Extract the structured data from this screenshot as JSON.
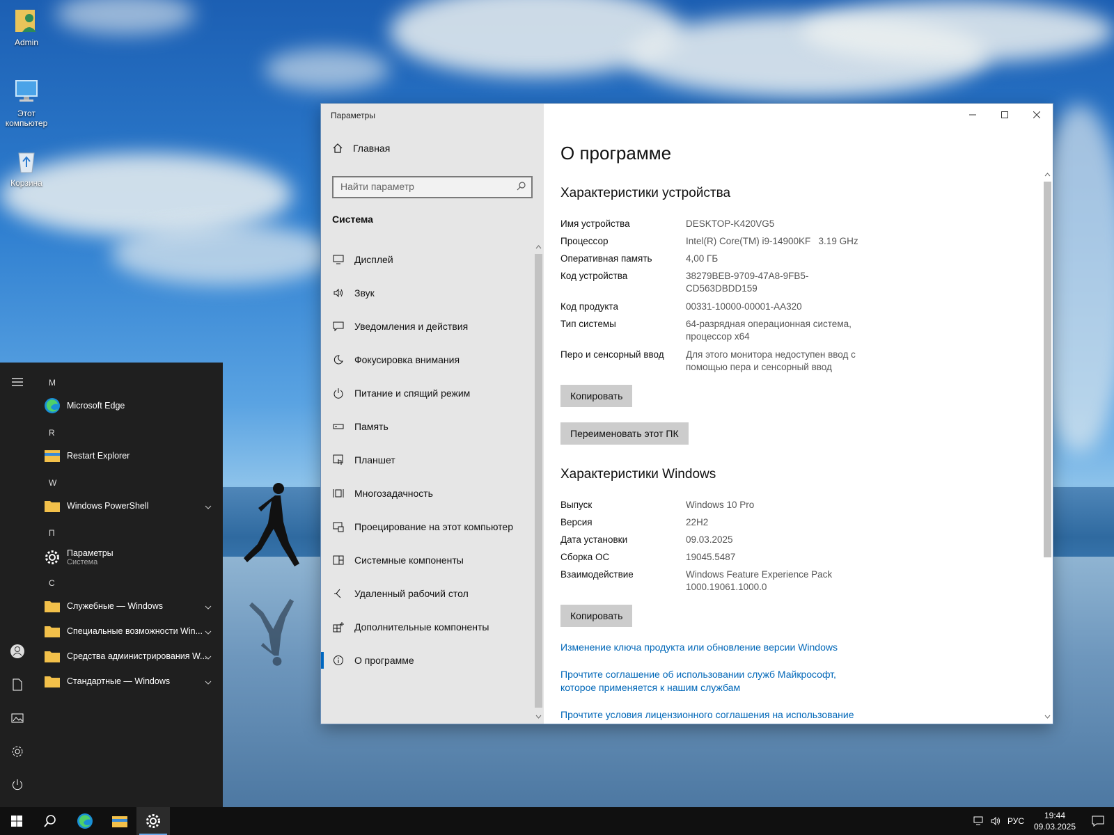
{
  "desktop": {
    "icons": [
      {
        "label": "Admin"
      },
      {
        "label": "Этот компьютер"
      },
      {
        "label": "Корзина"
      }
    ]
  },
  "settings": {
    "window_title": "Параметры",
    "home_label": "Главная",
    "search_placeholder": "Найти параметр",
    "section_label": "Система",
    "nav_items": [
      {
        "label": "Дисплей",
        "icon": "display-icon"
      },
      {
        "label": "Звук",
        "icon": "sound-icon"
      },
      {
        "label": "Уведомления и действия",
        "icon": "notifications-icon"
      },
      {
        "label": "Фокусировка внимания",
        "icon": "focus-icon"
      },
      {
        "label": "Питание и спящий режим",
        "icon": "power-icon"
      },
      {
        "label": "Память",
        "icon": "storage-icon"
      },
      {
        "label": "Планшет",
        "icon": "tablet-icon"
      },
      {
        "label": "Многозадачность",
        "icon": "multitasking-icon"
      },
      {
        "label": "Проецирование на этот компьютер",
        "icon": "projecting-icon"
      },
      {
        "label": "Системные компоненты",
        "icon": "components-icon"
      },
      {
        "label": "Удаленный рабочий стол",
        "icon": "remote-desktop-icon"
      },
      {
        "label": "Дополнительные компоненты",
        "icon": "optional-features-icon"
      },
      {
        "label": "О программе",
        "icon": "info-icon",
        "active": true
      }
    ],
    "page_title": "О программе",
    "device_specs": {
      "heading": "Характеристики устройства",
      "rows": [
        {
          "k": "Имя устройства",
          "v": "DESKTOP-K420VG5"
        },
        {
          "k": "Процессор",
          "v": "Intel(R) Core(TM) i9-14900KF   3.19 GHz"
        },
        {
          "k": "Оперативная память",
          "v": "4,00 ГБ"
        },
        {
          "k": "Код устройства",
          "v": "38279BEB-9709-47A8-9FB5-CD563DBDD159"
        },
        {
          "k": "Код продукта",
          "v": "00331-10000-00001-AA320"
        },
        {
          "k": "Тип системы",
          "v": "64-разрядная операционная система, процессор x64"
        },
        {
          "k": "Перо и сенсорный ввод",
          "v": "Для этого монитора недоступен ввод с помощью пера и сенсорный ввод"
        }
      ],
      "copy_label": "Копировать",
      "rename_label": "Переименовать этот ПК"
    },
    "windows_specs": {
      "heading": "Характеристики Windows",
      "rows": [
        {
          "k": "Выпуск",
          "v": "Windows 10 Pro"
        },
        {
          "k": "Версия",
          "v": "22H2"
        },
        {
          "k": "Дата установки",
          "v": "09.03.2025"
        },
        {
          "k": "Сборка ОС",
          "v": "19045.5487"
        },
        {
          "k": "Взаимодействие",
          "v": "Windows Feature Experience Pack 1000.19061.1000.0"
        }
      ],
      "copy_label": "Копировать"
    },
    "links": [
      "Изменение ключа продукта или обновление версии Windows",
      "Прочтите соглашение об использовании служб Майкрософт, которое применяется к нашим службам",
      "Прочтите условия лицензионного соглашения на использование"
    ]
  },
  "start_menu": {
    "groups": [
      {
        "letter": "M",
        "apps": [
          {
            "label": "Microsoft Edge",
            "icon": "edge-icon"
          }
        ]
      },
      {
        "letter": "R",
        "apps": [
          {
            "label": "Restart Explorer",
            "icon": "explorer-icon"
          }
        ]
      },
      {
        "letter": "W",
        "apps": [
          {
            "label": "Windows PowerShell",
            "icon": "folder-icon",
            "expand": true
          }
        ]
      },
      {
        "letter": "П",
        "apps": [
          {
            "label": "Параметры",
            "sub": "Система",
            "icon": "gear-icon"
          }
        ]
      },
      {
        "letter": "С",
        "apps": [
          {
            "label": "Служебные — Windows",
            "icon": "folder-icon",
            "expand": true
          },
          {
            "label": "Специальные возможности Win...",
            "icon": "folder-icon",
            "expand": true
          },
          {
            "label": "Средства администрирования W...",
            "icon": "folder-icon",
            "expand": true
          },
          {
            "label": "Стандартные — Windows",
            "icon": "folder-icon",
            "expand": true
          }
        ]
      }
    ]
  },
  "taskbar": {
    "language": "РУС",
    "time": "19:44",
    "date": "09.03.2025"
  },
  "colors": {
    "accent": "#0067c0",
    "link": "#0067b8",
    "taskbar": "#101010",
    "start_bg": "#1f1f1f"
  }
}
